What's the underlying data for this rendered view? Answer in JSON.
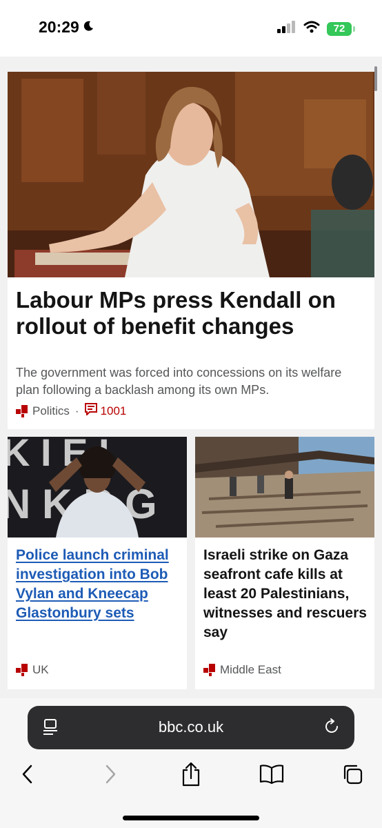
{
  "status_bar": {
    "time": "20:29",
    "battery": "72",
    "icons": [
      "moon-icon",
      "signal-icon",
      "wifi-icon",
      "battery-icon"
    ]
  },
  "lead_story": {
    "headline": "Labour MPs press Kendall on rollout of benefit changes",
    "summary": "The government was forced into concessions on its welfare plan following a backlash among its own MPs.",
    "topic": "Politics",
    "separator": "·",
    "comments": "1001"
  },
  "story_left": {
    "headline": "Police launch criminal investigation into Bob Vylan and Kneecap Glastonbury sets",
    "topic": "UK"
  },
  "story_right": {
    "headline": "Israeli strike on Gaza seafront cafe kills at least 20 Palestinians, witnesses and rescuers say",
    "topic": "Middle East"
  },
  "browser": {
    "url": "bbc.co.uk",
    "toolbar": [
      "back-icon",
      "forward-icon",
      "share-icon",
      "bookmarks-icon",
      "tabs-icon"
    ]
  },
  "colors": {
    "accent_red": "#b80000",
    "link_blue": "#1d5bb6",
    "battery_green": "#34c759"
  }
}
